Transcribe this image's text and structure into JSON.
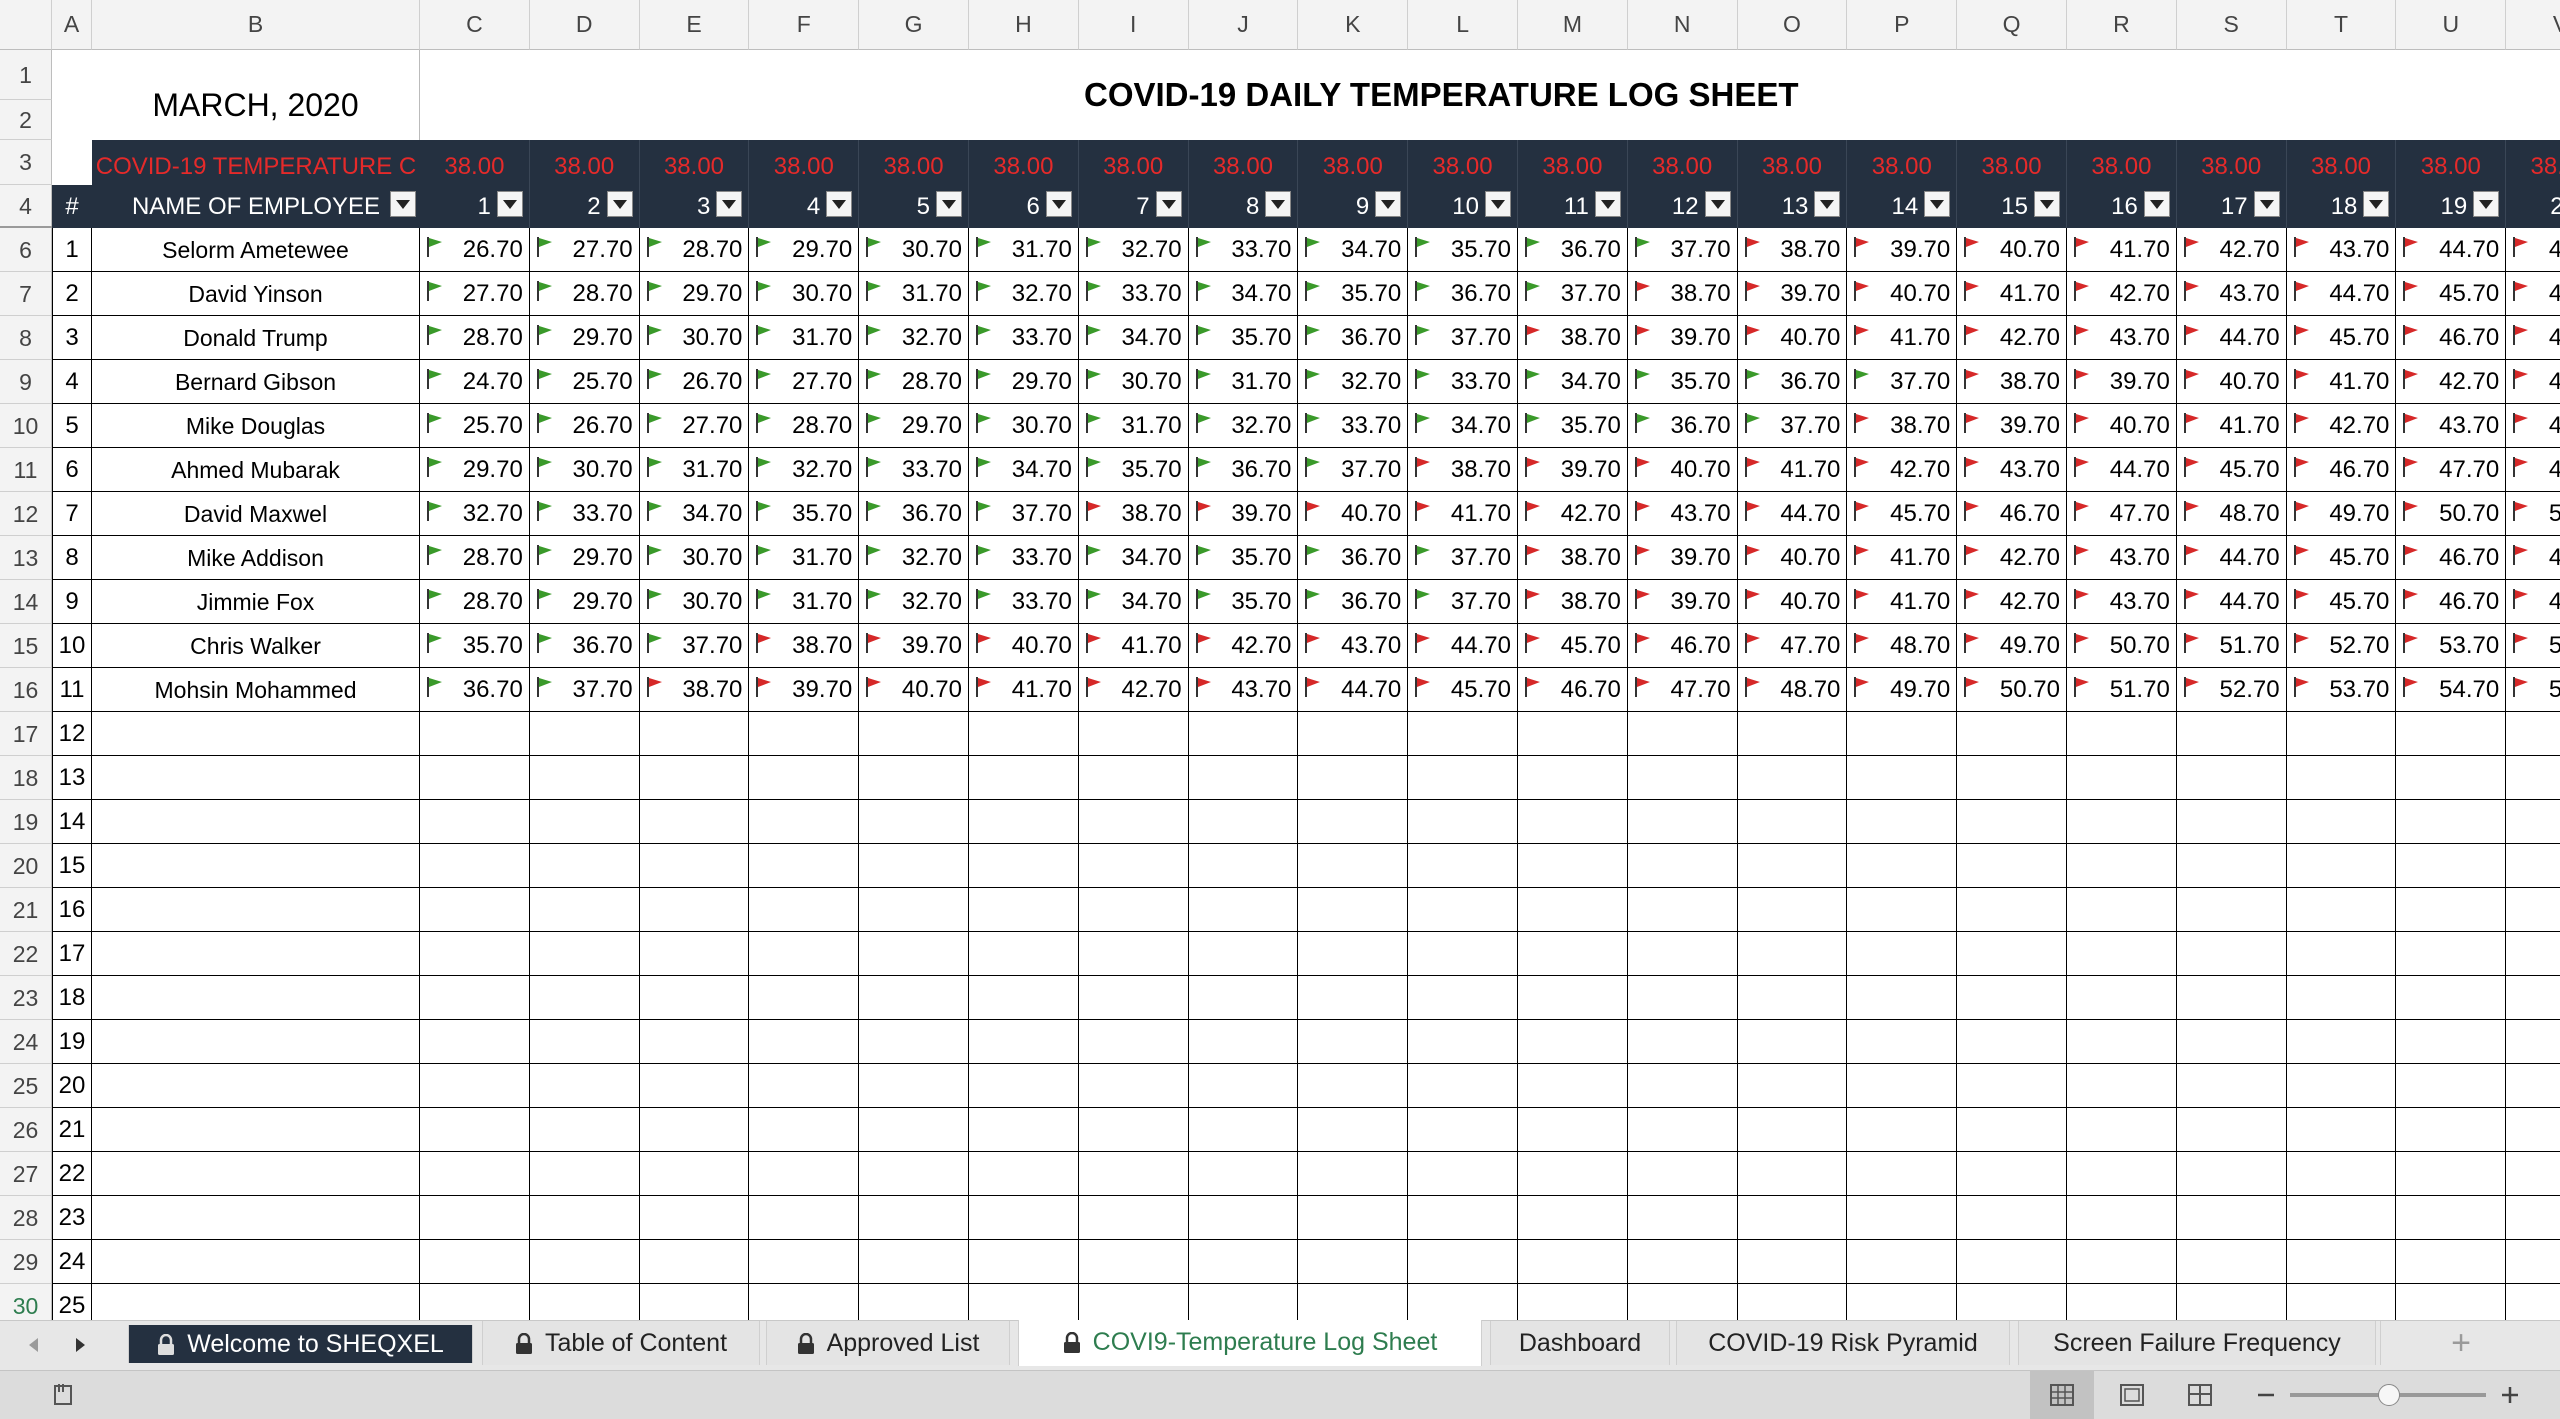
{
  "columns": [
    "A",
    "B",
    "C",
    "D",
    "E",
    "F",
    "G",
    "H",
    "I",
    "J",
    "K",
    "L",
    "M",
    "N",
    "O",
    "P",
    "Q",
    "R",
    "S",
    "T",
    "U",
    "V"
  ],
  "header": {
    "month": "MARCH, 2020",
    "title": "COVID-19 DAILY TEMPERATURE LOG SHEET",
    "threshold_label": "COVID-19 TEMPERATURE C",
    "threshold": "38.00",
    "hash": "#",
    "name_label": "NAME OF EMPLOYEE",
    "days": [
      "1",
      "2",
      "3",
      "4",
      "5",
      "6",
      "7",
      "8",
      "9",
      "10",
      "11",
      "12",
      "13",
      "14",
      "15",
      "16",
      "17",
      "18",
      "19",
      "20"
    ]
  },
  "employees": [
    {
      "row": "6",
      "no": "1",
      "name": "Selorm Ametewee",
      "start": 26.7
    },
    {
      "row": "7",
      "no": "2",
      "name": "David Yinson",
      "start": 27.7
    },
    {
      "row": "8",
      "no": "3",
      "name": "Donald Trump",
      "start": 28.7
    },
    {
      "row": "9",
      "no": "4",
      "name": "Bernard Gibson",
      "start": 24.7
    },
    {
      "row": "10",
      "no": "5",
      "name": "Mike Douglas",
      "start": 25.7
    },
    {
      "row": "11",
      "no": "6",
      "name": "Ahmed Mubarak",
      "start": 29.7
    },
    {
      "row": "12",
      "no": "7",
      "name": "David Maxwel",
      "start": 32.7
    },
    {
      "row": "13",
      "no": "8",
      "name": "Mike Addison",
      "start": 28.7
    },
    {
      "row": "14",
      "no": "9",
      "name": "Jimmie Fox",
      "start": 28.7
    },
    {
      "row": "15",
      "no": "10",
      "name": "Chris Walker",
      "start": 35.7
    },
    {
      "row": "16",
      "no": "11",
      "name": "Mohsin Mohammed",
      "start": 36.7
    }
  ],
  "empty_rows": [
    {
      "row": "17",
      "no": "12"
    },
    {
      "row": "18",
      "no": "13"
    },
    {
      "row": "19",
      "no": "14"
    },
    {
      "row": "20",
      "no": "15"
    },
    {
      "row": "21",
      "no": "16"
    },
    {
      "row": "22",
      "no": "17"
    },
    {
      "row": "23",
      "no": "18"
    },
    {
      "row": "24",
      "no": "19"
    },
    {
      "row": "25",
      "no": "20"
    },
    {
      "row": "26",
      "no": "21"
    },
    {
      "row": "27",
      "no": "22"
    },
    {
      "row": "28",
      "no": "23"
    },
    {
      "row": "29",
      "no": "24"
    },
    {
      "row": "30",
      "no": "25"
    }
  ],
  "tabs": [
    {
      "label": "Welcome to SHEQXEL",
      "locked": true,
      "style": "dark"
    },
    {
      "label": "Table of Content",
      "locked": true,
      "style": "normal"
    },
    {
      "label": "Approved List",
      "locked": true,
      "style": "normal"
    },
    {
      "label": "COVI9-Temperature Log Sheet",
      "locked": true,
      "style": "active"
    },
    {
      "label": "Dashboard",
      "locked": false,
      "style": "normal"
    },
    {
      "label": "COVID-19 Risk Pyramid",
      "locked": false,
      "style": "normal"
    },
    {
      "label": "Screen Failure Frequency",
      "locked": false,
      "style": "normal"
    }
  ],
  "colors": {
    "header_bg": "#243040",
    "threshold_red": "#e52a2a",
    "active_tab": "#2e7d4f",
    "flag_green": "#3a9a2a",
    "flag_red": "#d62828"
  },
  "icons": [
    "scroll-left-icon",
    "scroll-right-icon",
    "lock-icon",
    "add-sheet-icon",
    "status-macro-icon",
    "normal-view-icon",
    "page-layout-view-icon",
    "page-break-view-icon",
    "zoom-out-icon",
    "zoom-slider",
    "zoom-in-icon"
  ]
}
